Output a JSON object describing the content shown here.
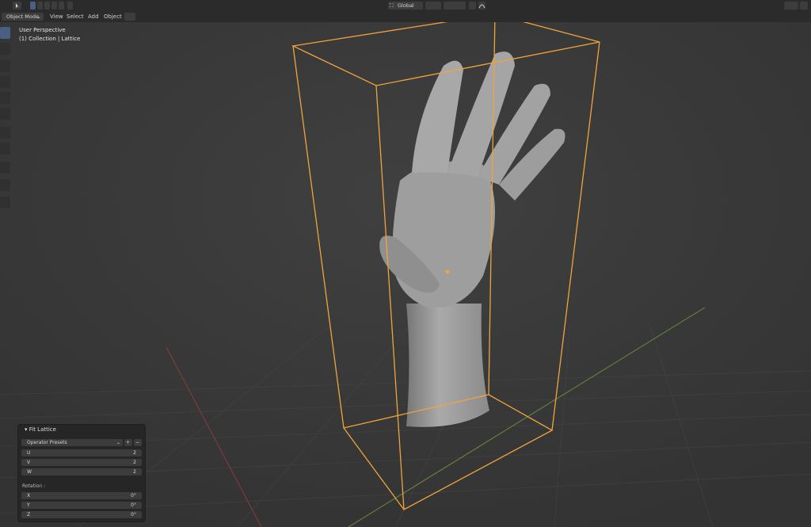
{
  "header": {
    "transform_orientation": "Global"
  },
  "menu": {
    "mode": "Object Mode",
    "view": "View",
    "select": "Select",
    "add": "Add",
    "object": "Object"
  },
  "viewport": {
    "perspective": "User Perspective",
    "collection": "(1) Collection | Lattice"
  },
  "operator_panel": {
    "title": "Fit Lattice",
    "presets": "Operator Presets",
    "resolution": [
      {
        "label": "U",
        "value": "2"
      },
      {
        "label": "V",
        "value": "2"
      },
      {
        "label": "W",
        "value": "2"
      }
    ],
    "rotation_label": "Rotation :",
    "rotation": [
      {
        "label": "X",
        "value": "0°"
      },
      {
        "label": "Y",
        "value": "0°"
      },
      {
        "label": "Z",
        "value": "0°"
      }
    ]
  },
  "colors": {
    "lattice": "#f0a43a",
    "x_axis": "#8a3b3f",
    "y_axis": "#6a8a3a",
    "active_blue": "#4a5f86"
  }
}
